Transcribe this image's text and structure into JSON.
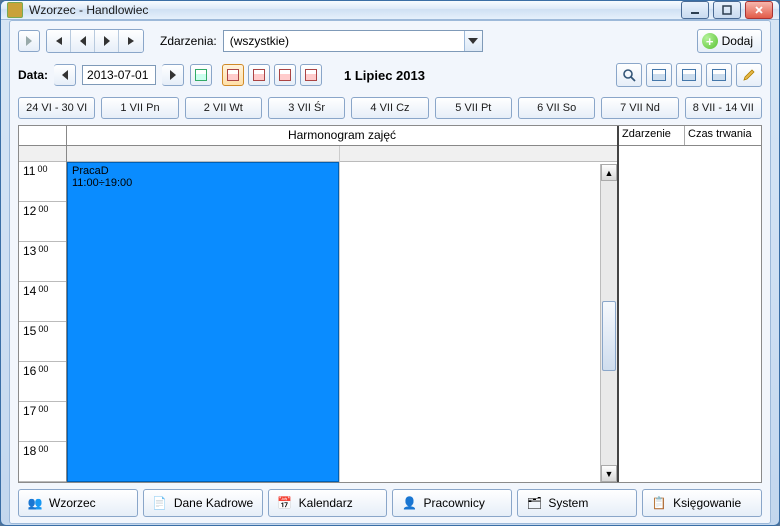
{
  "window": {
    "title": "Wzorzec - Handlowiec"
  },
  "toolbar": {
    "events_label": "Zdarzenia:",
    "events_value": "(wszystkie)",
    "add_label": "Dodaj",
    "date_label": "Data:",
    "date_value": "2013-07-01",
    "big_date": "1 Lipiec 2013"
  },
  "day_strip": [
    "24 VI - 30 VI",
    "1 VII Pn",
    "2 VII Wt",
    "3 VII Śr",
    "4 VII Cz",
    "5 VII Pt",
    "6 VII So",
    "7 VII Nd",
    "8 VII - 14 VII"
  ],
  "schedule": {
    "header": "Harmonogram zajęć",
    "hours": [
      "11",
      "12",
      "13",
      "14",
      "15",
      "16",
      "17",
      "18"
    ],
    "minute_label": "00",
    "appointment": {
      "title": "PracaD",
      "time": "11:00÷19:00"
    }
  },
  "side": {
    "col1": "Zdarzenie",
    "col2": "Czas trwania"
  },
  "tabs": [
    "Wzorzec",
    "Dane Kadrowe",
    "Kalendarz",
    "Pracownicy",
    "System",
    "Księgowanie"
  ]
}
